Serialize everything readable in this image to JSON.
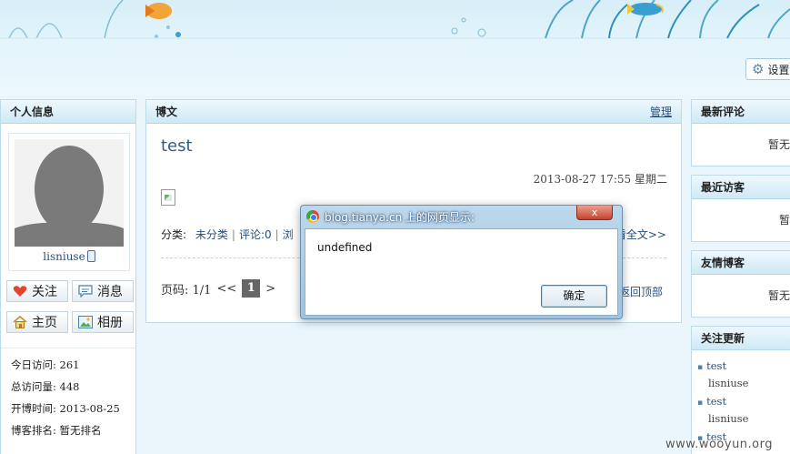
{
  "header": {
    "settings_label": "设置"
  },
  "profile": {
    "title": "个人信息",
    "username": "lisniuse",
    "buttons": {
      "follow": "关注",
      "message": "消息",
      "home": "主页",
      "album": "相册"
    },
    "stats": [
      "今日访问:  261",
      "总访问量: 448",
      "开博时间: 2013-08-25",
      "博客排名: 暂无排名"
    ]
  },
  "blog": {
    "title": "博文",
    "manage": "管理",
    "post": {
      "title": "test",
      "date": "2013-08-27 17:55 星期二",
      "category_label": "分类:",
      "category": "未分类",
      "comments": "评论:0",
      "more": "浏",
      "read_full": "看全文>>"
    },
    "pager": {
      "label": "页码: 1/1",
      "prev": "<<",
      "current": "1",
      "next": ">"
    },
    "back_to_top": "返回顶部"
  },
  "sidebar": {
    "latest_comments": {
      "title": "最新评论",
      "empty": "暂无"
    },
    "recent_visitors": {
      "title": "最近访客",
      "empty": "暂"
    },
    "friend_blogs": {
      "title": "友情博客",
      "empty": "暂无"
    },
    "follow_updates": {
      "title": "关注更新",
      "items": [
        {
          "title": "test",
          "user": "lisniuse"
        },
        {
          "title": "test",
          "user": "lisniuse"
        },
        {
          "title": "test",
          "user": ""
        }
      ]
    }
  },
  "dialog": {
    "title": "blog.tianya.cn 上的网页显示:",
    "message": "undefined",
    "ok": "确定",
    "close": "x"
  },
  "watermark": "www.wooyun.org"
}
